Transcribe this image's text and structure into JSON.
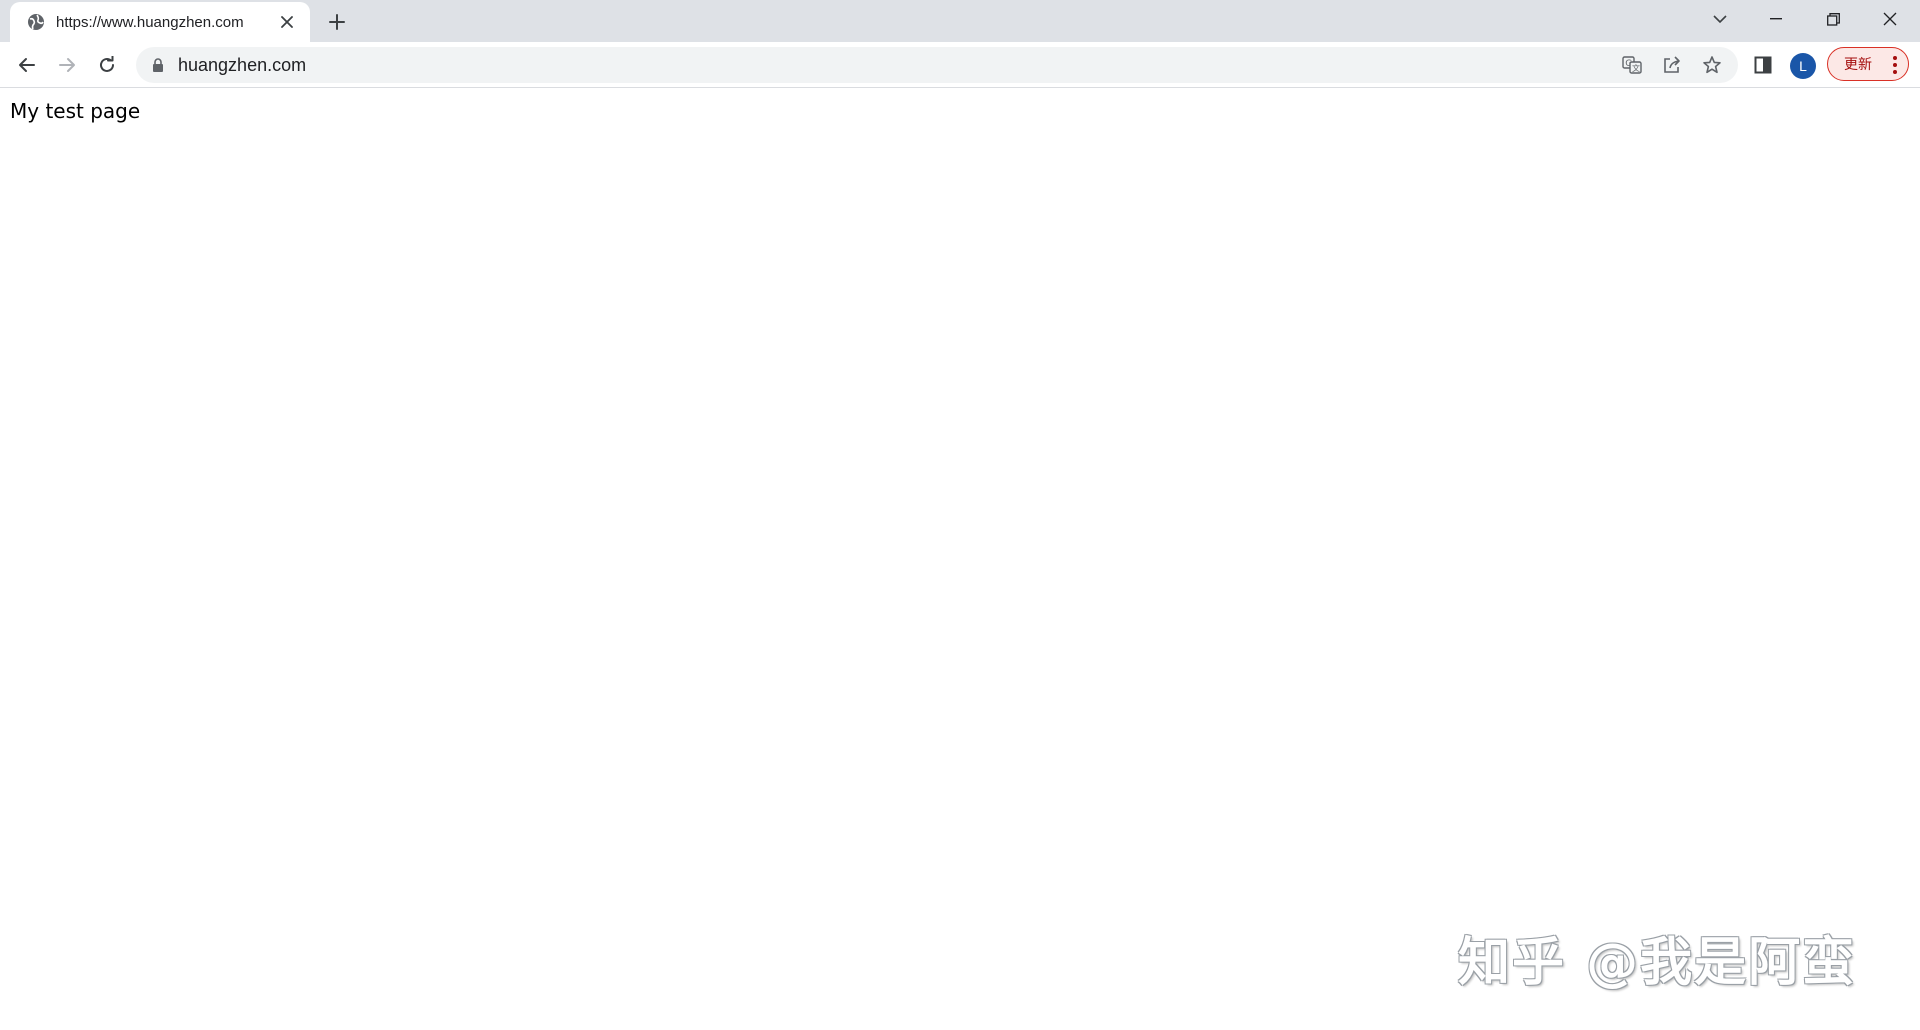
{
  "browser": {
    "tab": {
      "title": "https://www.huangzhen.com",
      "favicon": "globe-icon",
      "close_icon": "close-icon"
    },
    "new_tab_icon": "plus-icon",
    "window_controls": [
      "chevron-down-icon",
      "minimize-icon",
      "restore-icon",
      "close-icon"
    ],
    "toolbar": {
      "back_icon": "arrow-left-icon",
      "forward_icon": "arrow-right-icon",
      "reload_icon": "reload-icon",
      "lock_icon": "lock-icon",
      "url": "huangzhen.com",
      "omnibox_icons": [
        "translate-icon",
        "share-icon",
        "star-icon"
      ],
      "side_panel_icon": "side-panel-icon",
      "avatar_letter": "L",
      "update_label": "更新",
      "menu_icon": "kebab-menu-icon"
    },
    "colors": {
      "tabstrip_bg": "#dee1e6",
      "omnibox_bg": "#f1f3f4",
      "avatar_bg": "#1a56a8",
      "update_border": "#d93025",
      "update_text": "#a50e0e"
    }
  },
  "page": {
    "text": "My test page"
  },
  "watermark": {
    "text": "知乎 @我是阿蛮"
  }
}
